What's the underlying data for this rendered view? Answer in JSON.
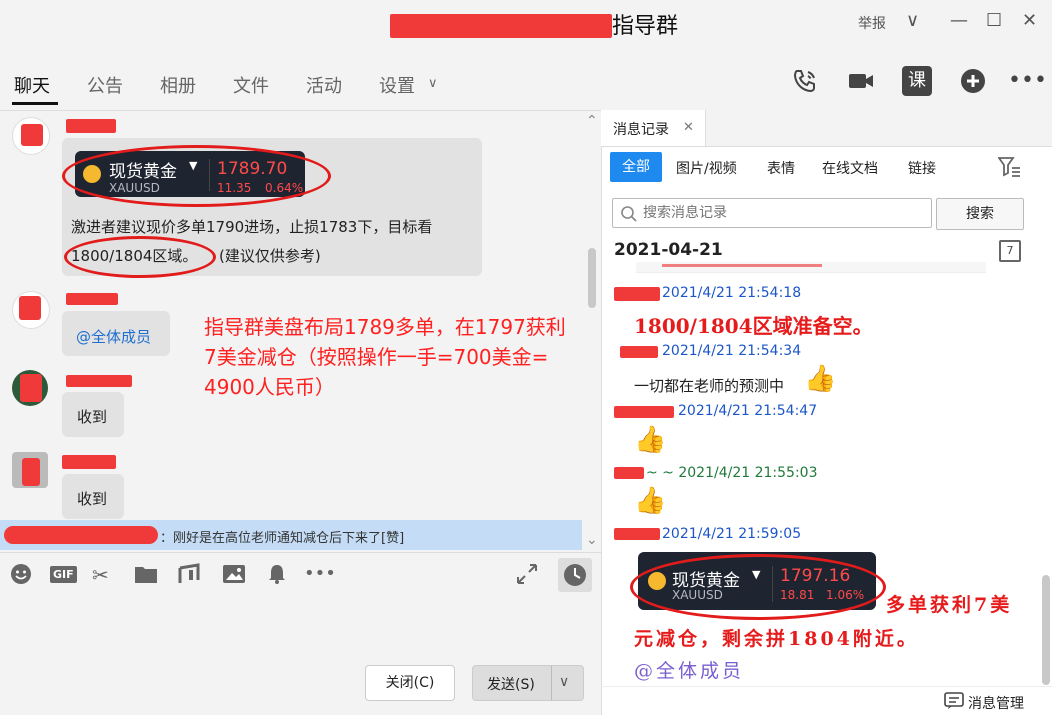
{
  "window": {
    "title": "指导群",
    "report": "举报",
    "ctrl_chevron": "∨",
    "ctrl_min": "—",
    "ctrl_max": "☐",
    "ctrl_close": "✕"
  },
  "tabs": [
    "聊天",
    "公告",
    "相册",
    "文件",
    "活动",
    "设置"
  ],
  "tab_settings_arrow": "∨",
  "top_icons": {
    "course": "课"
  },
  "chat": {
    "card1": {
      "name": "现货黄金",
      "symbol": "XAUUSD",
      "price": "1789.70",
      "change": "11.35",
      "pct": "0.64%"
    },
    "msg1_line1": "激进者建议现价多单1790进场，止损1783下，目标看",
    "msg1_line2_a": "1800/1804区域。",
    "msg1_line2_b": "(建议仅供参考)",
    "msg2": "@全体成员",
    "msg3": "收到",
    "msg4": "收到",
    "annotation": [
      "指导群美盘布局1789多单，在1797获利",
      "7美金减仓（按照操作一手=700美金=",
      "4900人民币）"
    ],
    "notify": "：刚好是在高位老师通知减仓后下来了[赞]"
  },
  "input": {
    "close_label": "关闭(C)",
    "send_label": "发送(S)",
    "gif_label": "GIF"
  },
  "history": {
    "tab_label": "消息记录",
    "filters": [
      "全部",
      "图片/视频",
      "表情",
      "在线文档",
      "链接"
    ],
    "search_placeholder": "搜索消息记录",
    "search_button": "搜索",
    "date": "2021-04-21",
    "calendar_day": "7",
    "entries": [
      {
        "time": "2021/4/21 21:54:18",
        "text": "1800/1804区域准备空。"
      },
      {
        "time": "2021/4/21 21:54:34",
        "text": "一切都在老师的预测中"
      },
      {
        "time": "2021/4/21 21:54:47"
      },
      {
        "time": "~ ~ 2021/4/21 21:55:03"
      },
      {
        "time": "2021/4/21 21:59:05"
      }
    ],
    "card2": {
      "name": "现货黄金",
      "symbol": "XAUUSD",
      "price": "1797.16",
      "change": "18.81",
      "pct": "1.06%"
    },
    "handnote": [
      "多单获利7美",
      "元减仓，剩余拼1804附近。",
      "@全体成员"
    ],
    "manage_label": "消息管理"
  }
}
